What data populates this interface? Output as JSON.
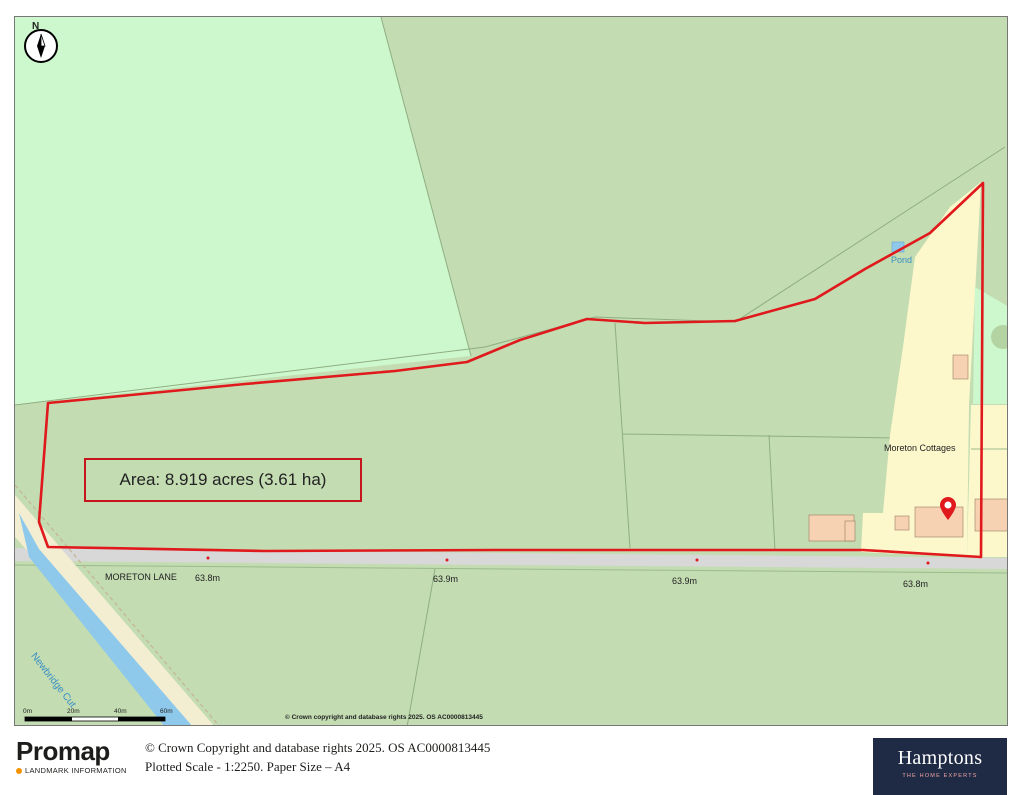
{
  "map": {
    "area_label": "Area: 8.919 acres (3.61 ha)",
    "place_labels": {
      "pond": "Pond",
      "moreton_cottages": "Moreton Cottages",
      "moreton_lane": "MORETON LANE",
      "newbridge_cut": "Newbridge Cut"
    },
    "spot_heights": [
      "63.8m",
      "63.9m",
      "63.9m",
      "63.8m"
    ],
    "north_label": "N",
    "scale_bar": {
      "ticks": [
        "0m",
        "20m",
        "40m",
        "60m"
      ]
    },
    "copyright_small": "© Crown copyright and database rights 2025. OS AC0000813445",
    "colors": {
      "boundary": "#e0191d",
      "field_dark": "#c3dcb2",
      "field_light": "#cdf8cd",
      "property": "#fdf8cc",
      "building": "#f6d2b3",
      "road": "#d8d8d8",
      "water": "#8ec9ec"
    }
  },
  "footer": {
    "brand": "Promap",
    "brand_sub": "LANDMARK INFORMATION",
    "copyright_line": "© Crown Copyright and database rights 2025. OS AC0000813445",
    "scale_line": "Plotted Scale - 1:2250. Paper Size – A4",
    "agent_logo": "Hamptons",
    "agent_tagline": "THE HOME EXPERTS"
  }
}
